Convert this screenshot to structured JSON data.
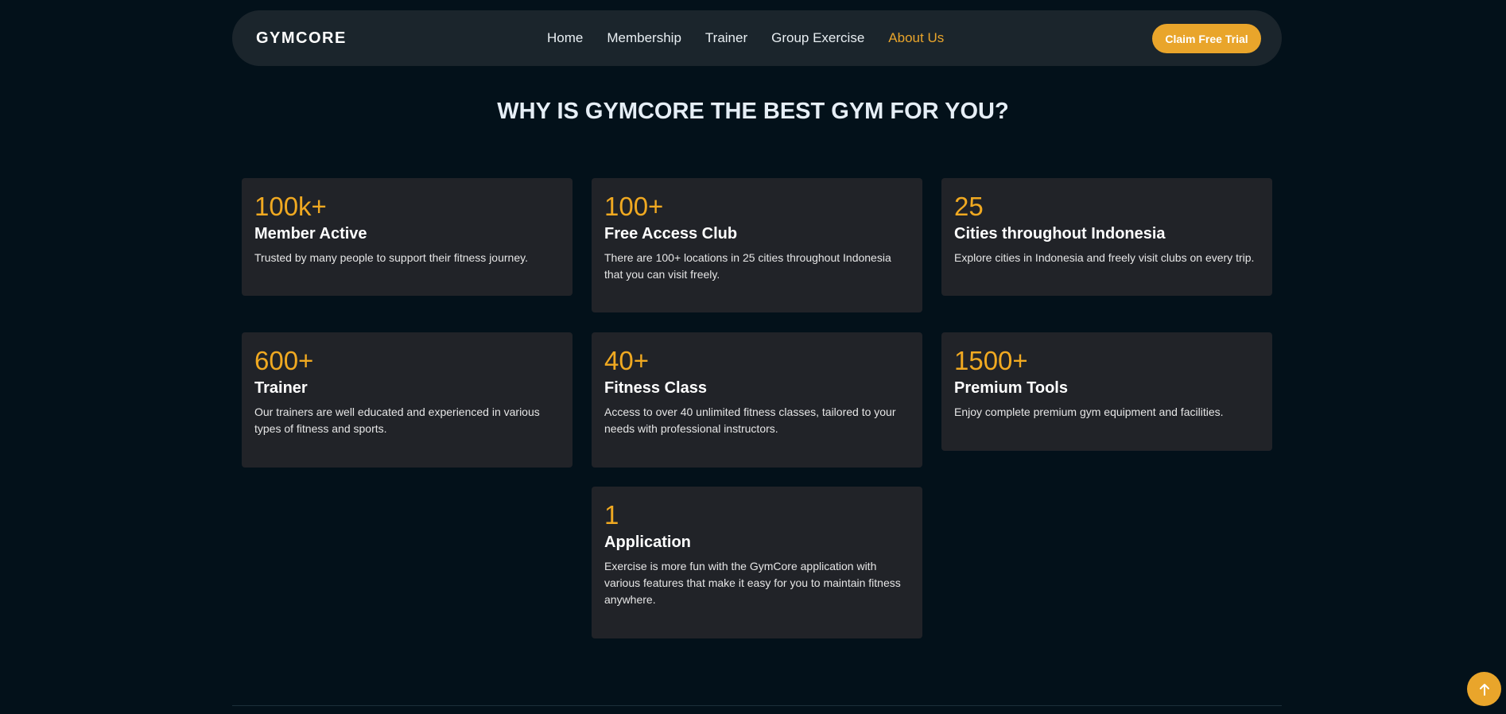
{
  "brand": {
    "logo": "GYMCORE"
  },
  "nav": {
    "items": [
      {
        "label": "Home"
      },
      {
        "label": "Membership"
      },
      {
        "label": "Trainer"
      },
      {
        "label": "Group Exercise"
      },
      {
        "label": "About Us",
        "active": true
      }
    ],
    "cta_label": "Claim Free Trial"
  },
  "section": {
    "title": "WHY IS GYMCORE THE BEST GYM FOR YOU?"
  },
  "cards": [
    {
      "stat": "100k+",
      "title": "Member Active",
      "desc": "Trusted by many people to support their fitness journey."
    },
    {
      "stat": "100+",
      "title": "Free Access Club",
      "desc": "There are 100+ locations in 25 cities throughout Indonesia that you can visit freely."
    },
    {
      "stat": "25",
      "title": "Cities throughout Indonesia",
      "desc": "Explore cities in Indonesia and freely visit clubs on every trip."
    },
    {
      "stat": "600+",
      "title": "Trainer",
      "desc": "Our trainers are well educated and experienced in various types of fitness and sports."
    },
    {
      "stat": "40+",
      "title": "Fitness Class",
      "desc": "Access to over 40 unlimited fitness classes, tailored to your needs with professional instructors."
    },
    {
      "stat": "1500+",
      "title": "Premium Tools",
      "desc": "Enjoy complete premium gym equipment and facilities."
    },
    {
      "stat": "1",
      "title": "Application",
      "desc": "Exercise is more fun with the GymCore application with various features that make it easy for you to maintain fitness anywhere."
    }
  ],
  "icons": {
    "scroll_top": "arrow-up-icon"
  },
  "colors": {
    "accent": "#e9a52b",
    "stat": "#f0a921",
    "background": "#03111a",
    "card": "#212328",
    "nav": "#1b252c"
  }
}
